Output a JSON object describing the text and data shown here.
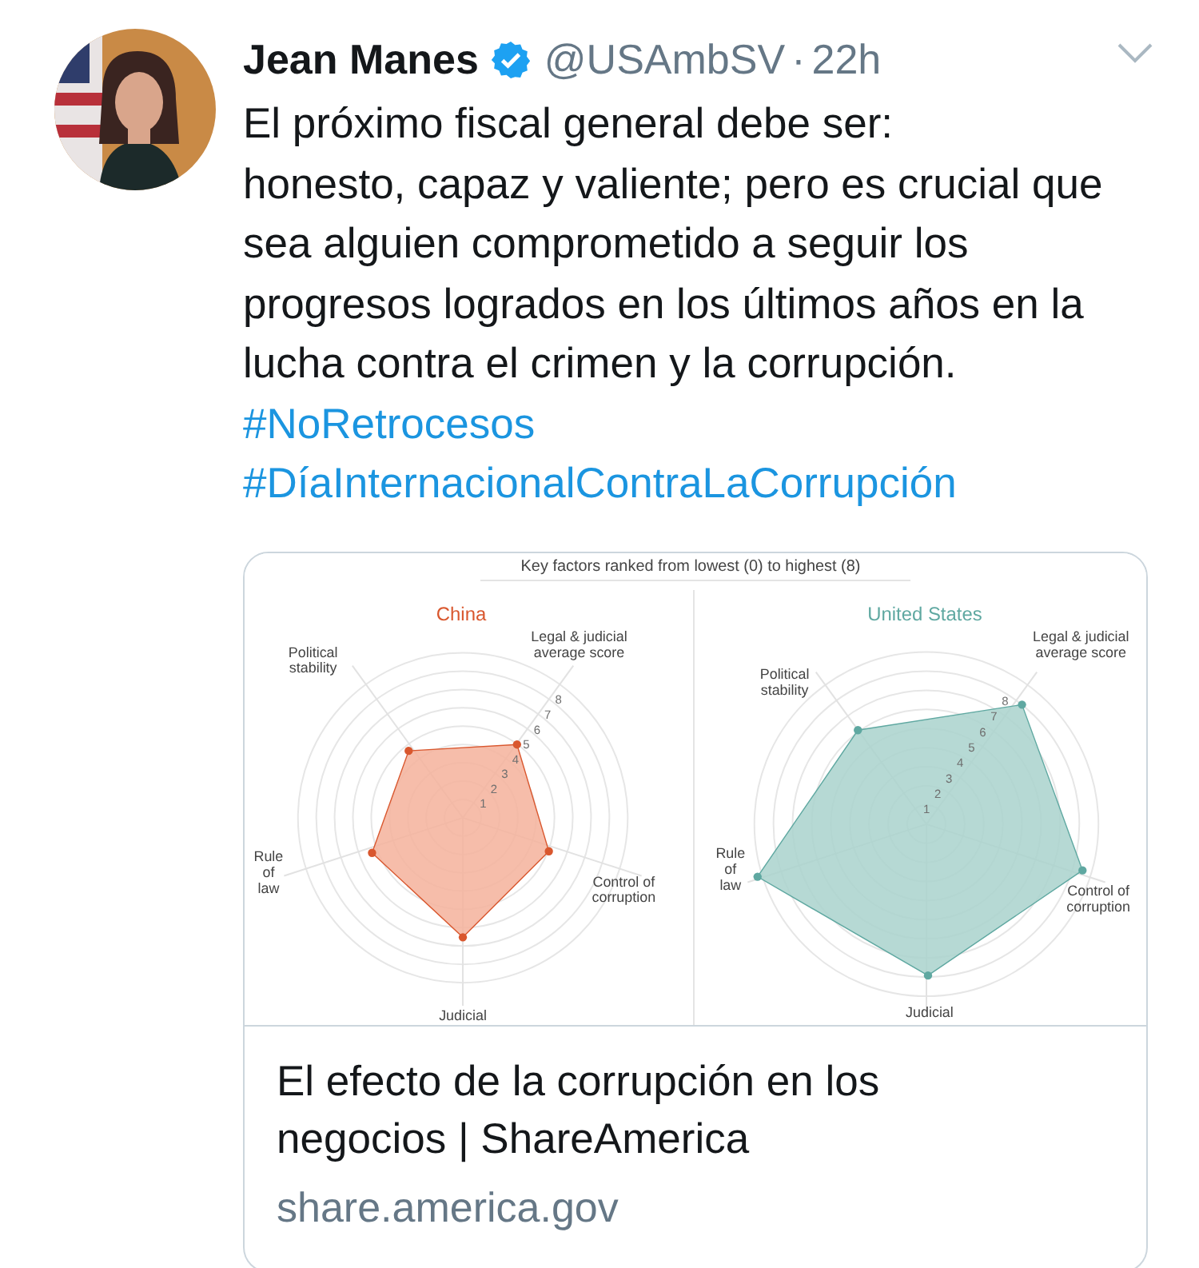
{
  "author": {
    "name": "Jean Manes",
    "verified": true,
    "handle": "@USAmbSV",
    "separator": "·",
    "time": "22h"
  },
  "tweet": {
    "text": "El próximo fiscal general debe ser:\nhonesto, capaz y valiente; pero es crucial que sea alguien comprometido a seguir los progresos logrados en los últimos años en la lucha contra el crimen y la corrupción.",
    "hashtags": [
      "#NoRetrocesos",
      "#DíaInternacionalContraLaCorrupción"
    ]
  },
  "card": {
    "image": {
      "subtitle": "Key factors ranked from lowest (0) to highest (8)",
      "panels": [
        {
          "title": "China",
          "color": "#d9572e",
          "ticks": [
            "1",
            "2",
            "3",
            "4",
            "5",
            "6",
            "7",
            "8"
          ],
          "axes": [
            {
              "lines": [
                "Legal & judicial",
                "average score"
              ]
            },
            {
              "lines": [
                "Control of",
                "corruption"
              ]
            },
            {
              "lines": [
                "Judicial"
              ]
            },
            {
              "lines": [
                "Rule",
                "of",
                "law"
              ]
            },
            {
              "lines": [
                "Political",
                "stability"
              ]
            }
          ]
        },
        {
          "title": "United States",
          "color": "#5fa8a1",
          "ticks": [
            "8",
            "7",
            "6",
            "5",
            "4",
            "3",
            "2",
            "1"
          ],
          "axes": [
            {
              "lines": [
                "Legal & judicial",
                "average score"
              ]
            },
            {
              "lines": [
                "Control of",
                "corruption"
              ]
            },
            {
              "lines": [
                "Judicial"
              ]
            },
            {
              "lines": [
                "Rule",
                "of",
                "law"
              ]
            },
            {
              "lines": [
                "Political",
                "stability"
              ]
            }
          ]
        }
      ]
    },
    "title": "El efecto de la corrupción en los negocios | ShareAmerica",
    "domain": "share.america.gov"
  }
}
